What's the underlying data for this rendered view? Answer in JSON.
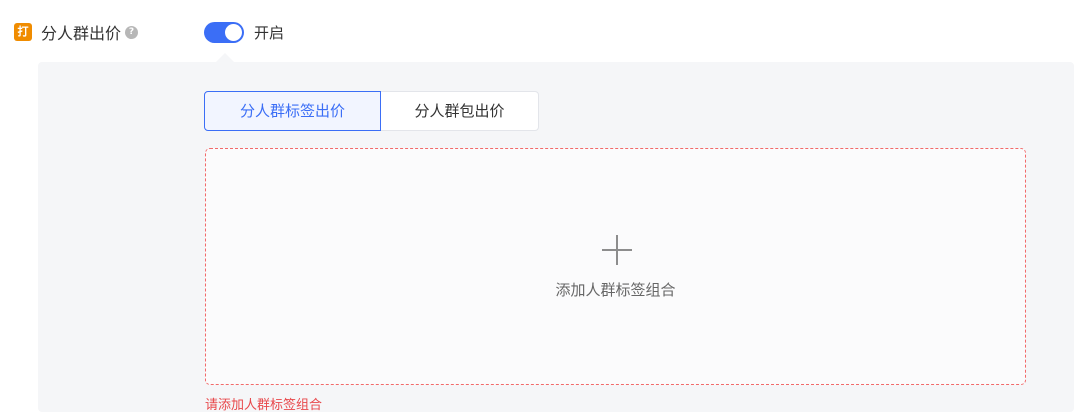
{
  "setting": {
    "badge_text": "打",
    "label": "分人群出价",
    "help_icon": "question-circle-icon",
    "toggle_state": "on",
    "toggle_text": "开启"
  },
  "tabs": [
    {
      "label": "分人群标签出价",
      "active": true
    },
    {
      "label": "分人群包出价",
      "active": false
    }
  ],
  "add_box": {
    "icon": "plus-icon",
    "label": "添加人群标签组合"
  },
  "validation": {
    "error": "请添加人群标签组合"
  },
  "colors": {
    "accent": "#3b6ef6",
    "badge": "#f08c00",
    "error": "#e8484b",
    "panel_bg": "#f5f6f8"
  }
}
